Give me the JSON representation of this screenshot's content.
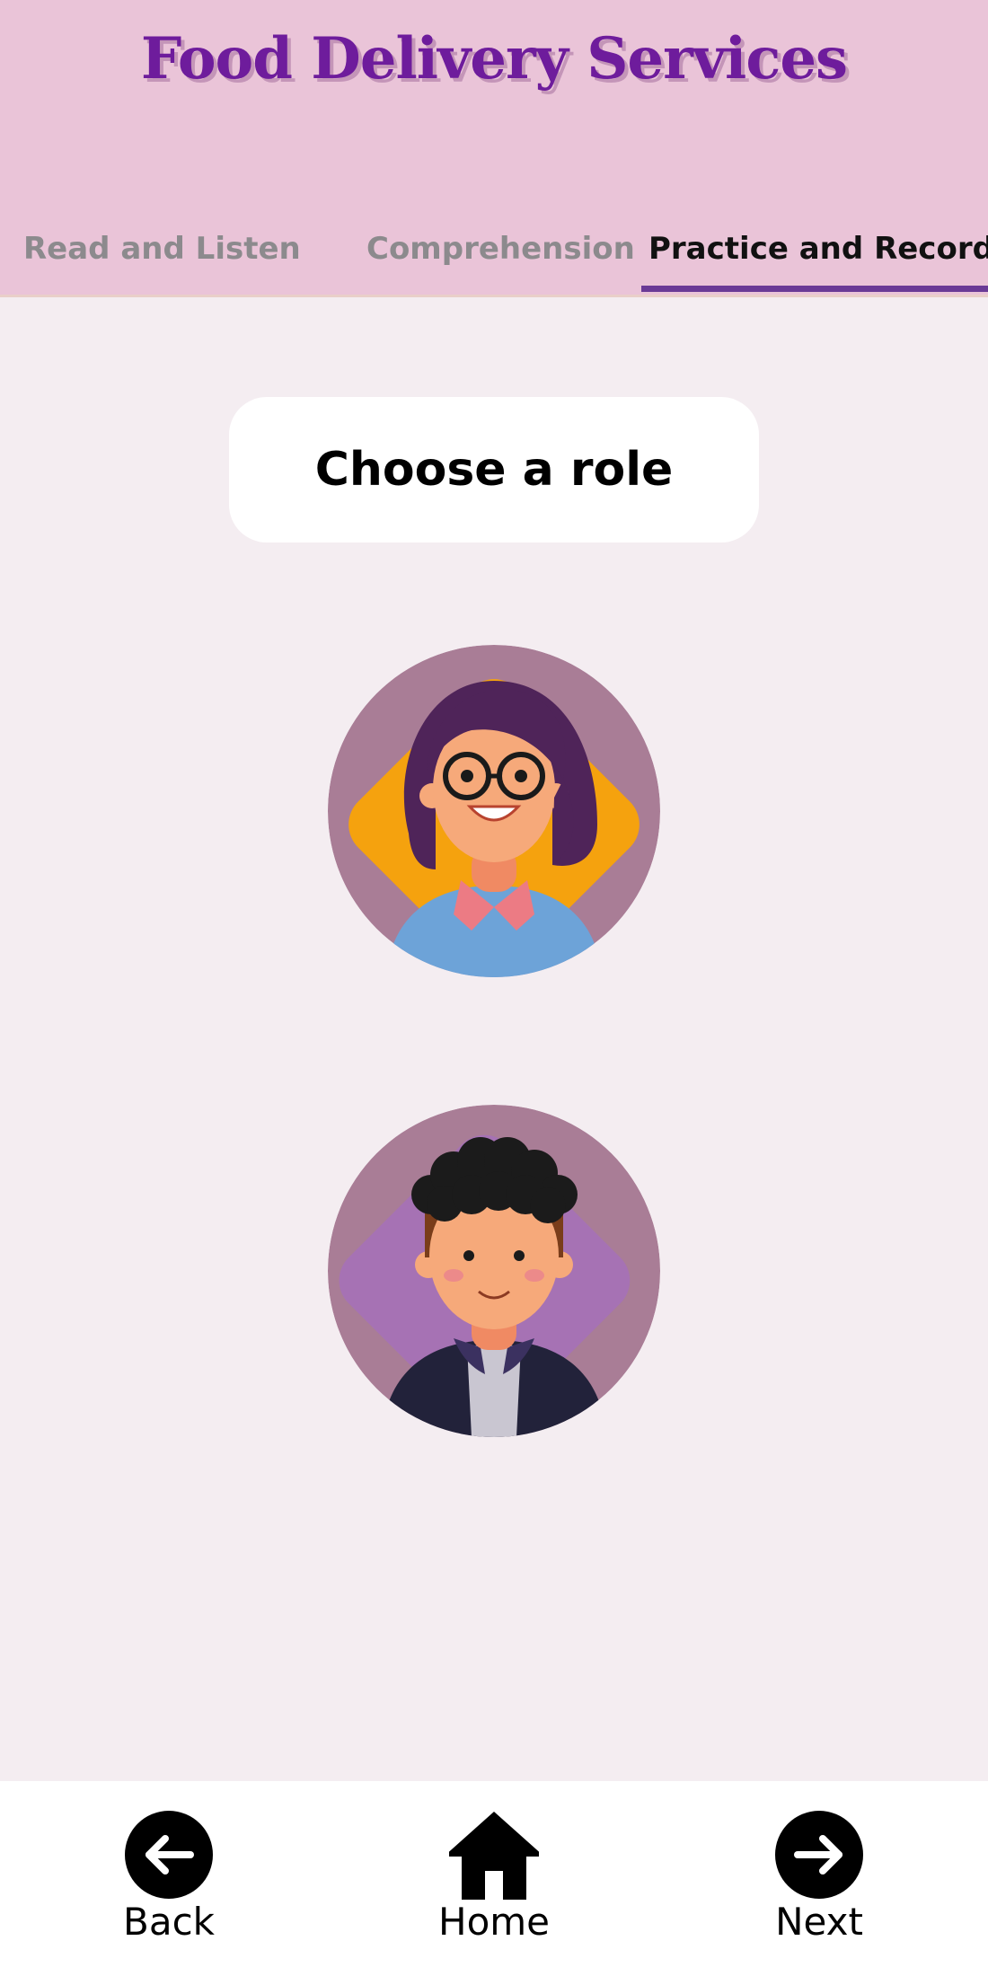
{
  "header": {
    "title": "Food Delivery Services",
    "tabs": [
      {
        "label": "Read and Listen",
        "active": false
      },
      {
        "label": "Comprehension",
        "active": false
      },
      {
        "label": "Practice and Record",
        "active": true
      }
    ]
  },
  "main": {
    "heading": "Choose a role",
    "roles": [
      {
        "icon": "female-avatar-icon"
      },
      {
        "icon": "male-avatar-icon"
      }
    ]
  },
  "footer": {
    "back_label": "Back",
    "home_label": "Home",
    "next_label": "Next",
    "icons": [
      "arrow-left-icon",
      "home-icon",
      "arrow-right-icon"
    ]
  },
  "colors": {
    "header_bg": "#eac4d8",
    "title": "#6e1c9c",
    "active_tab_underline": "#6a3a96",
    "page_bg": "#f4edf1"
  }
}
